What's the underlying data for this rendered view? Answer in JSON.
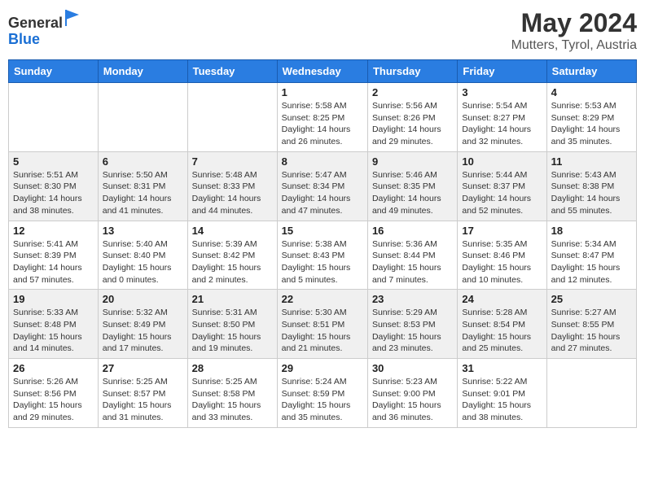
{
  "logo": {
    "general": "General",
    "blue": "Blue"
  },
  "title": "May 2024",
  "subtitle": "Mutters, Tyrol, Austria",
  "days_header": [
    "Sunday",
    "Monday",
    "Tuesday",
    "Wednesday",
    "Thursday",
    "Friday",
    "Saturday"
  ],
  "weeks": [
    [
      {
        "num": "",
        "info": ""
      },
      {
        "num": "",
        "info": ""
      },
      {
        "num": "",
        "info": ""
      },
      {
        "num": "1",
        "info": "Sunrise: 5:58 AM\nSunset: 8:25 PM\nDaylight: 14 hours\nand 26 minutes."
      },
      {
        "num": "2",
        "info": "Sunrise: 5:56 AM\nSunset: 8:26 PM\nDaylight: 14 hours\nand 29 minutes."
      },
      {
        "num": "3",
        "info": "Sunrise: 5:54 AM\nSunset: 8:27 PM\nDaylight: 14 hours\nand 32 minutes."
      },
      {
        "num": "4",
        "info": "Sunrise: 5:53 AM\nSunset: 8:29 PM\nDaylight: 14 hours\nand 35 minutes."
      }
    ],
    [
      {
        "num": "5",
        "info": "Sunrise: 5:51 AM\nSunset: 8:30 PM\nDaylight: 14 hours\nand 38 minutes."
      },
      {
        "num": "6",
        "info": "Sunrise: 5:50 AM\nSunset: 8:31 PM\nDaylight: 14 hours\nand 41 minutes."
      },
      {
        "num": "7",
        "info": "Sunrise: 5:48 AM\nSunset: 8:33 PM\nDaylight: 14 hours\nand 44 minutes."
      },
      {
        "num": "8",
        "info": "Sunrise: 5:47 AM\nSunset: 8:34 PM\nDaylight: 14 hours\nand 47 minutes."
      },
      {
        "num": "9",
        "info": "Sunrise: 5:46 AM\nSunset: 8:35 PM\nDaylight: 14 hours\nand 49 minutes."
      },
      {
        "num": "10",
        "info": "Sunrise: 5:44 AM\nSunset: 8:37 PM\nDaylight: 14 hours\nand 52 minutes."
      },
      {
        "num": "11",
        "info": "Sunrise: 5:43 AM\nSunset: 8:38 PM\nDaylight: 14 hours\nand 55 minutes."
      }
    ],
    [
      {
        "num": "12",
        "info": "Sunrise: 5:41 AM\nSunset: 8:39 PM\nDaylight: 14 hours\nand 57 minutes."
      },
      {
        "num": "13",
        "info": "Sunrise: 5:40 AM\nSunset: 8:40 PM\nDaylight: 15 hours\nand 0 minutes."
      },
      {
        "num": "14",
        "info": "Sunrise: 5:39 AM\nSunset: 8:42 PM\nDaylight: 15 hours\nand 2 minutes."
      },
      {
        "num": "15",
        "info": "Sunrise: 5:38 AM\nSunset: 8:43 PM\nDaylight: 15 hours\nand 5 minutes."
      },
      {
        "num": "16",
        "info": "Sunrise: 5:36 AM\nSunset: 8:44 PM\nDaylight: 15 hours\nand 7 minutes."
      },
      {
        "num": "17",
        "info": "Sunrise: 5:35 AM\nSunset: 8:46 PM\nDaylight: 15 hours\nand 10 minutes."
      },
      {
        "num": "18",
        "info": "Sunrise: 5:34 AM\nSunset: 8:47 PM\nDaylight: 15 hours\nand 12 minutes."
      }
    ],
    [
      {
        "num": "19",
        "info": "Sunrise: 5:33 AM\nSunset: 8:48 PM\nDaylight: 15 hours\nand 14 minutes."
      },
      {
        "num": "20",
        "info": "Sunrise: 5:32 AM\nSunset: 8:49 PM\nDaylight: 15 hours\nand 17 minutes."
      },
      {
        "num": "21",
        "info": "Sunrise: 5:31 AM\nSunset: 8:50 PM\nDaylight: 15 hours\nand 19 minutes."
      },
      {
        "num": "22",
        "info": "Sunrise: 5:30 AM\nSunset: 8:51 PM\nDaylight: 15 hours\nand 21 minutes."
      },
      {
        "num": "23",
        "info": "Sunrise: 5:29 AM\nSunset: 8:53 PM\nDaylight: 15 hours\nand 23 minutes."
      },
      {
        "num": "24",
        "info": "Sunrise: 5:28 AM\nSunset: 8:54 PM\nDaylight: 15 hours\nand 25 minutes."
      },
      {
        "num": "25",
        "info": "Sunrise: 5:27 AM\nSunset: 8:55 PM\nDaylight: 15 hours\nand 27 minutes."
      }
    ],
    [
      {
        "num": "26",
        "info": "Sunrise: 5:26 AM\nSunset: 8:56 PM\nDaylight: 15 hours\nand 29 minutes."
      },
      {
        "num": "27",
        "info": "Sunrise: 5:25 AM\nSunset: 8:57 PM\nDaylight: 15 hours\nand 31 minutes."
      },
      {
        "num": "28",
        "info": "Sunrise: 5:25 AM\nSunset: 8:58 PM\nDaylight: 15 hours\nand 33 minutes."
      },
      {
        "num": "29",
        "info": "Sunrise: 5:24 AM\nSunset: 8:59 PM\nDaylight: 15 hours\nand 35 minutes."
      },
      {
        "num": "30",
        "info": "Sunrise: 5:23 AM\nSunset: 9:00 PM\nDaylight: 15 hours\nand 36 minutes."
      },
      {
        "num": "31",
        "info": "Sunrise: 5:22 AM\nSunset: 9:01 PM\nDaylight: 15 hours\nand 38 minutes."
      },
      {
        "num": "",
        "info": ""
      }
    ]
  ]
}
